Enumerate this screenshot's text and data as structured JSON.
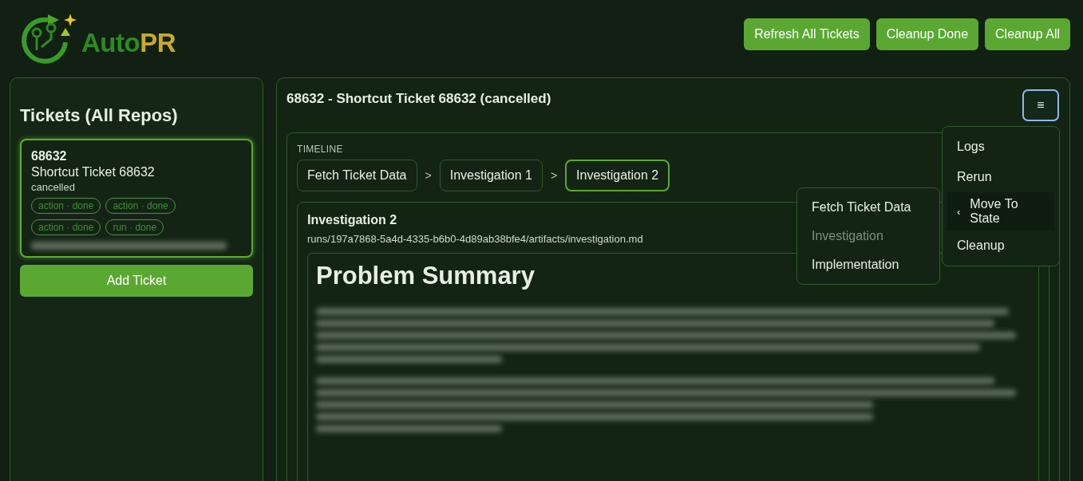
{
  "header": {
    "logo": [
      "Auto",
      "PR"
    ],
    "buttons": [
      "Refresh All Tickets",
      "Cleanup Done",
      "Cleanup All"
    ]
  },
  "sidebar": {
    "title": "Tickets (All Repos)",
    "tickets": [
      {
        "id": "68632",
        "title": "Shortcut Ticket 68632",
        "status": "cancelled",
        "selected": true,
        "tags": [
          "action · done",
          "action · done",
          "action · done",
          "run · done"
        ]
      }
    ],
    "add_button": "Add Ticket"
  },
  "detail": {
    "title": "68632 - Shortcut Ticket 68632 (cancelled)",
    "menu_button": "≡",
    "timeline": {
      "label": "TIMELINE",
      "separators": [
        ">",
        ">"
      ],
      "steps": [
        {
          "label": "Fetch Ticket Data",
          "selected": false
        },
        {
          "label": "Investigation 1",
          "selected": false
        },
        {
          "label": "Investigation 2",
          "selected": true
        }
      ]
    },
    "artifact": {
      "title": "Investigation 2",
      "path": "runs/197a7868-5a4d-4335-b6b0-4d89ab38bfe4/artifacts/investigation.md",
      "heading": "Problem Summary"
    }
  },
  "menu": {
    "items": [
      {
        "label": "Logs",
        "kind": "item"
      },
      {
        "label": "Rerun",
        "kind": "item"
      },
      {
        "label": "Move To State",
        "kind": "submenu",
        "expanded": true,
        "arrow": "‹"
      },
      {
        "label": "Cleanup",
        "kind": "item"
      }
    ],
    "submenu": [
      {
        "label": "Fetch Ticket Data",
        "disabled": false
      },
      {
        "label": "Investigation",
        "disabled": true
      },
      {
        "label": "Implementation",
        "disabled": false
      }
    ]
  }
}
